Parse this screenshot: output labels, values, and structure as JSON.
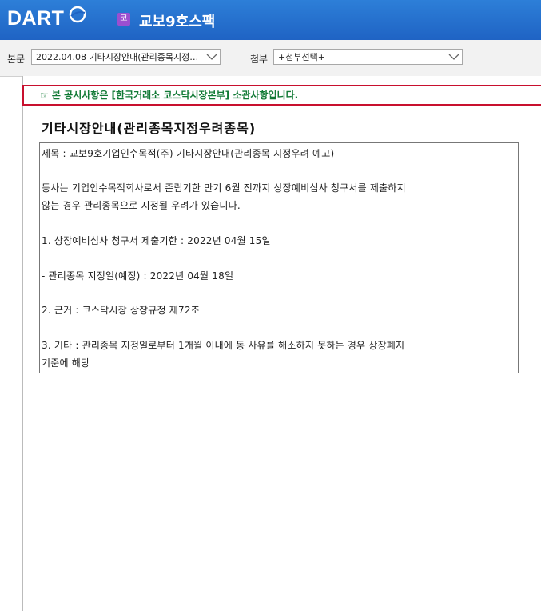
{
  "header": {
    "logo": "DART",
    "badge": "코",
    "company": "교보9호스팩"
  },
  "toolbar": {
    "body_label": "본문",
    "body_select": "2022.04.08  기타시장안내(관리종목지정…",
    "attach_label": "첨부",
    "attach_select": "+첨부선택+"
  },
  "notice": "☞ 본 공시사항은 [한국거래소 코스닥시장본부] 소관사항입니다.",
  "doc": {
    "title": "기타시장안내(관리종목지정우려종목)",
    "lines": [
      "제목 : 교보9호기업인수목적(주) 기타시장안내(관리종목 지정우려 예고)",
      "동사는 기업인수목적회사로서 존립기한 만기 6월 전까지 상장예비심사 청구서를 제출하지",
      "않는 경우 관리종목으로 지정될 우려가 있습니다.",
      "1. 상장예비심사 청구서 제출기한 : 2022년 04월 15일",
      "- 관리종목 지정일(예정) : 2022년 04월 18일",
      "2. 근거 : 코스닥시장 상장규정 제72조",
      "3. 기타 : 관리종목 지정일로부터 1개월 이내에 동 사유를 해소하지 못하는 경우 상장폐지",
      "기준에 해당"
    ]
  }
}
